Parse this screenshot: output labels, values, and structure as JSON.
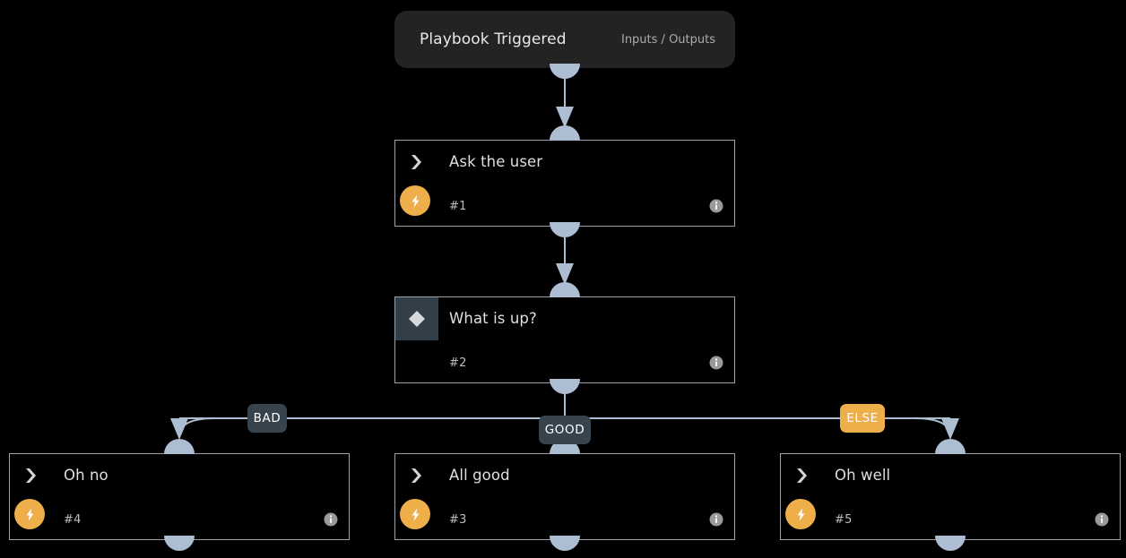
{
  "app": {
    "canvas_background": "#000000",
    "accent_amber": "#eeaf4b",
    "accent_slate": "#37444e",
    "port_color": "#adbdd2",
    "edge_color": "#adbdd2"
  },
  "trigger": {
    "title": "Playbook Triggered",
    "io_label": "Inputs / Outputs",
    "background": "#232323"
  },
  "nodes": [
    {
      "id": "step1",
      "kind": "action",
      "title": "Ask the user",
      "number": "#1",
      "icon": "chevron-right-icon",
      "badge": "lightning-bolt-icon",
      "info": "info-icon"
    },
    {
      "id": "step2",
      "kind": "decision",
      "title": "What is up?",
      "number": "#2",
      "icon": "diamond-icon",
      "badge": null,
      "info": "info-icon"
    },
    {
      "id": "step4",
      "kind": "action",
      "title": "Oh no",
      "number": "#4",
      "icon": "chevron-right-icon",
      "badge": "lightning-bolt-icon",
      "info": "info-icon"
    },
    {
      "id": "step3",
      "kind": "action",
      "title": "All good",
      "number": "#3",
      "icon": "chevron-right-icon",
      "badge": "lightning-bolt-icon",
      "info": "info-icon"
    },
    {
      "id": "step5",
      "kind": "action",
      "title": "Oh well",
      "number": "#5",
      "icon": "chevron-right-icon",
      "badge": "lightning-bolt-icon",
      "info": "info-icon"
    }
  ],
  "branches": [
    {
      "label": "BAD",
      "style": "slate",
      "target": "step4"
    },
    {
      "label": "GOOD",
      "style": "slate",
      "target": "step3"
    },
    {
      "label": "ELSE",
      "style": "amber",
      "target": "step5"
    }
  ]
}
